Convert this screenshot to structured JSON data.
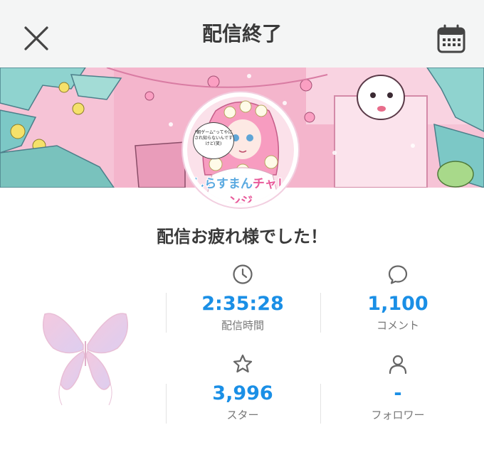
{
  "header": {
    "title": "配信終了"
  },
  "avatar": {
    "bubble_text": "\"朝ゲーム\"ってやにされ知らないんですけど(笑)",
    "logo_part1": "しらすまん",
    "logo_part2": "チャレンジ"
  },
  "message": "配信お疲れ様でした！",
  "stats": [
    {
      "icon": "clock-icon",
      "value": "2:35:28",
      "label": "配信時間"
    },
    {
      "icon": "comment-icon",
      "value": "1,100",
      "label": "コメント"
    },
    {
      "icon": "star-icon",
      "value": "3,996",
      "label": "スター"
    },
    {
      "icon": "person-icon",
      "value": "-",
      "label": "フォロワー"
    }
  ],
  "colors": {
    "accent": "#1a8fe6",
    "header_bg": "#f4f5f5",
    "banner_pink": "#f7c6d9",
    "banner_teal": "#8fd3cf"
  }
}
